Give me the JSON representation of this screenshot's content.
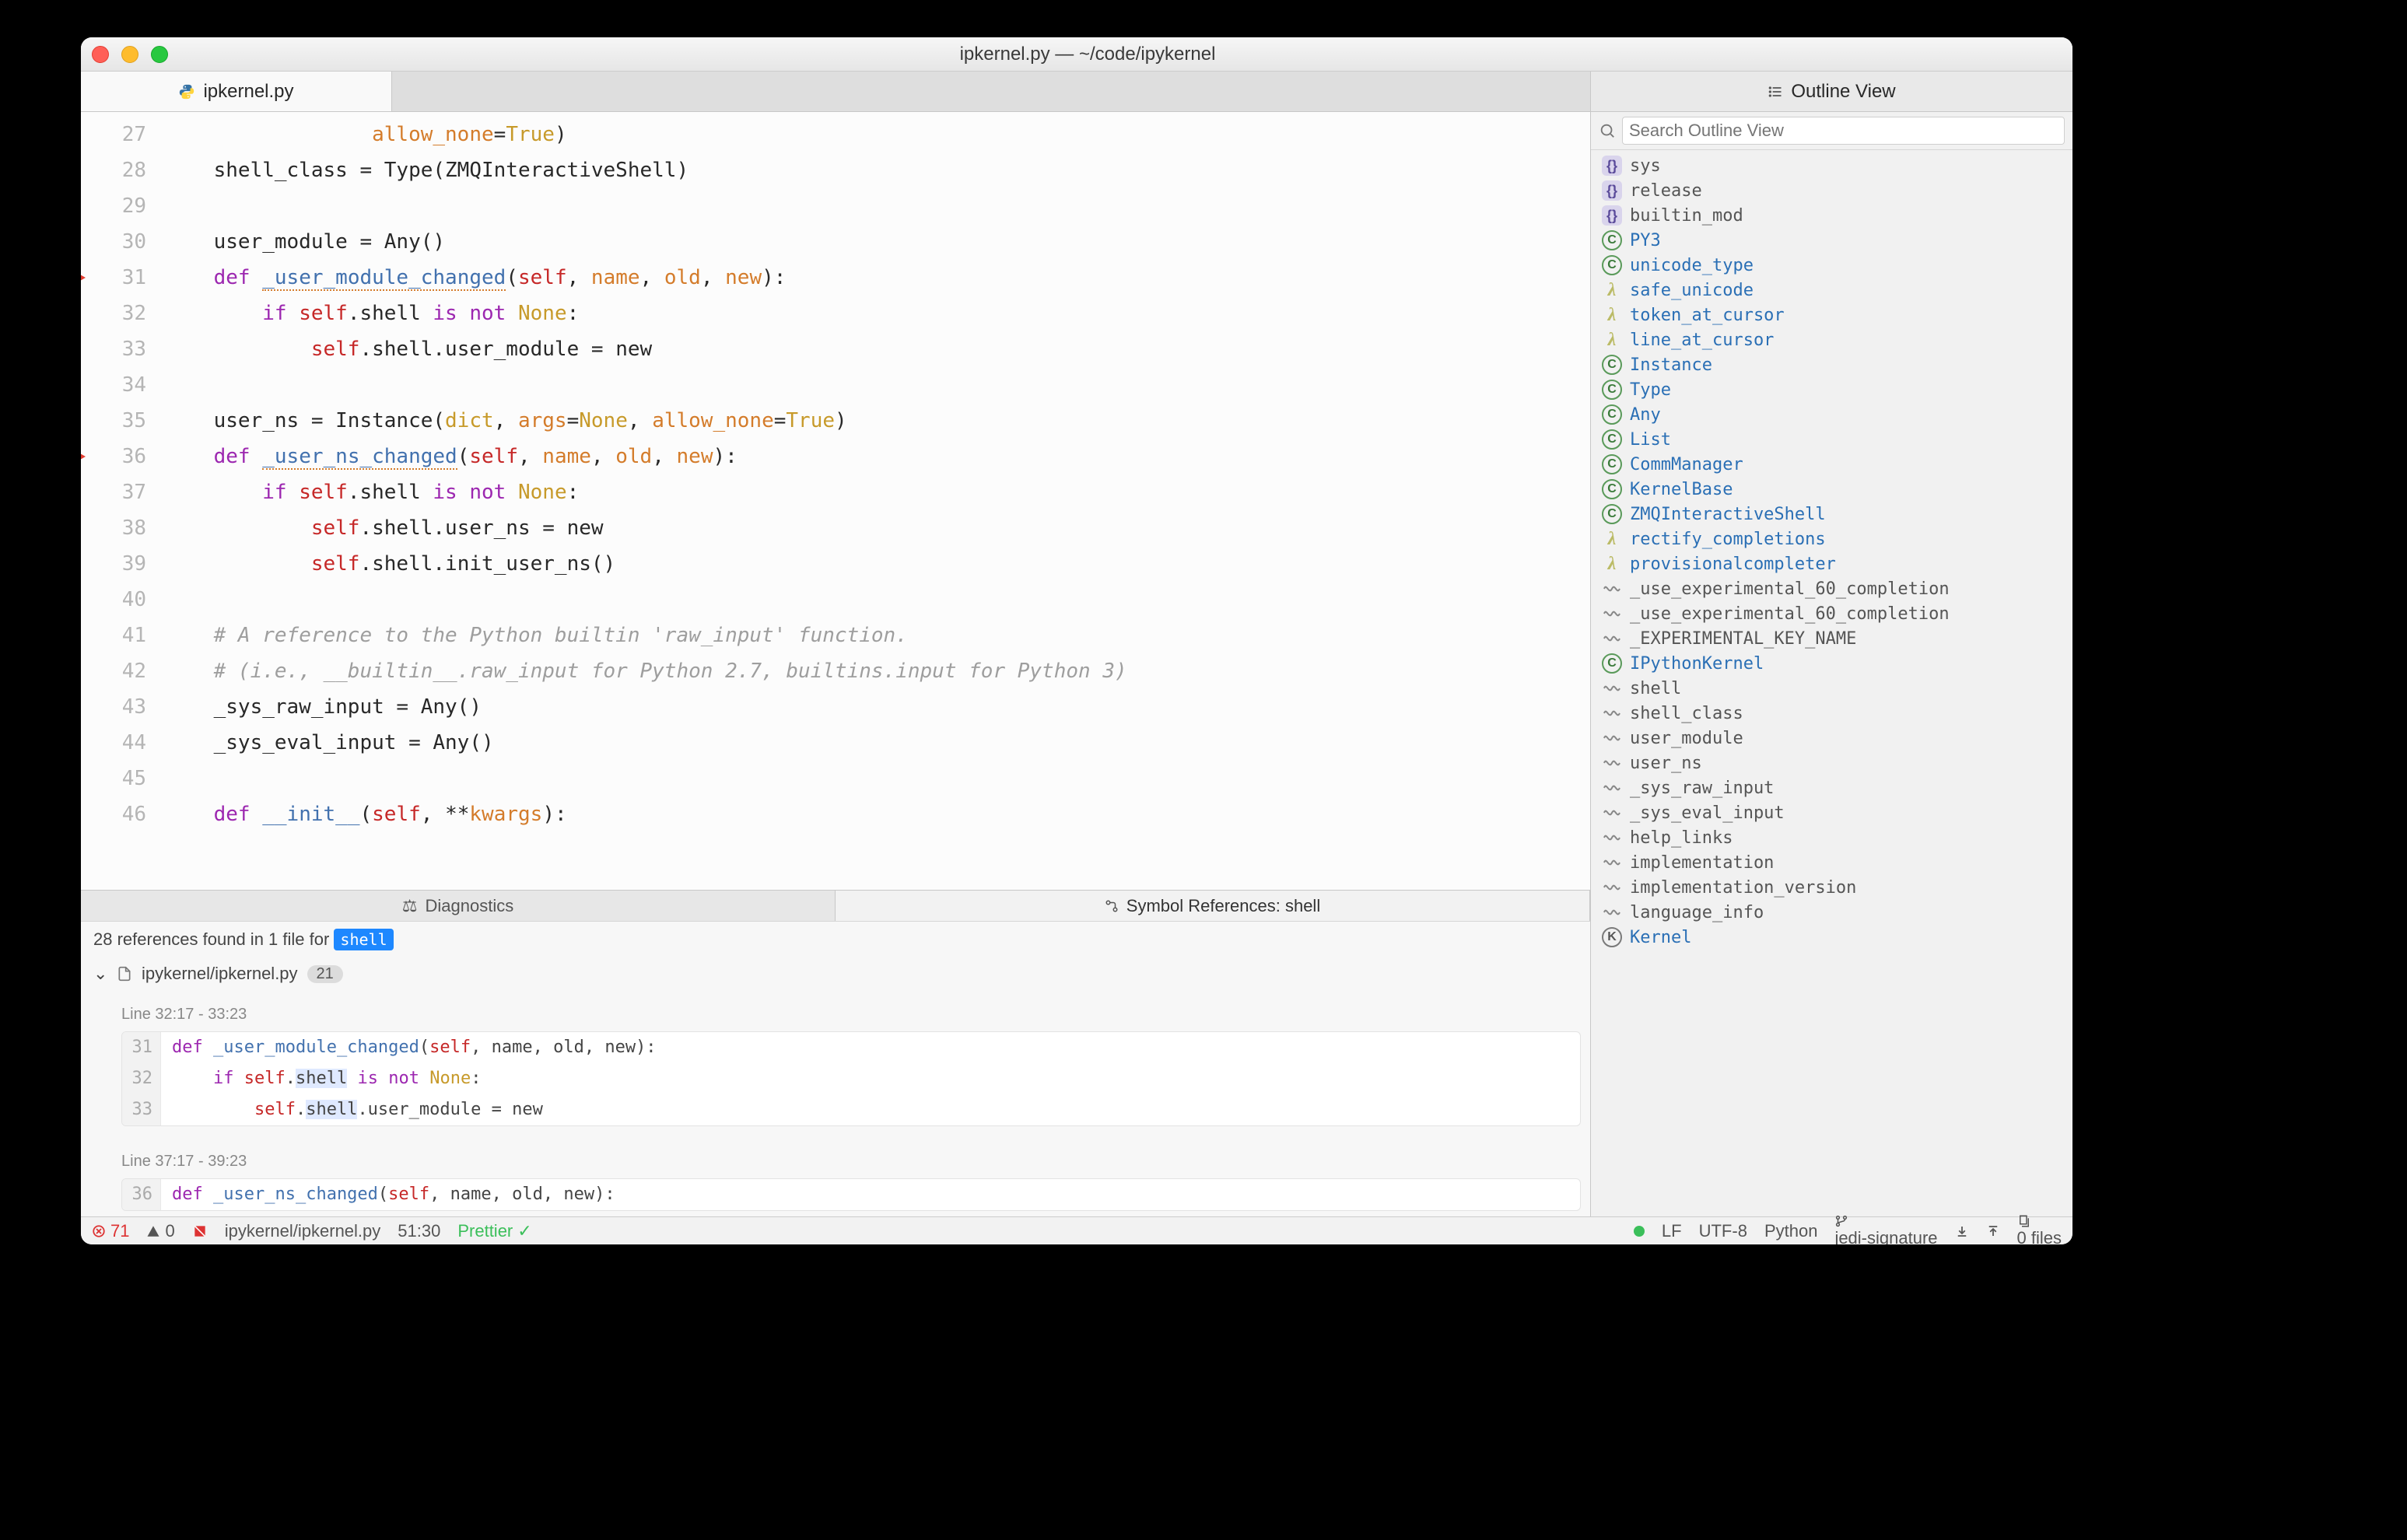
{
  "titlebar": {
    "title": "ipkernel.py — ~/code/ipykernel"
  },
  "tabs": {
    "active_label": "ipkernel.py"
  },
  "outline_header": "Outline View",
  "outline_search_placeholder": "Search Outline View",
  "editor": {
    "lines": [
      {
        "n": 27,
        "html": "                 <span class='arg'>allow_none</span>=<span class='const'>True</span>)"
      },
      {
        "n": 28,
        "html": "    shell_class = Type(ZMQInteractiveShell)"
      },
      {
        "n": 29,
        "html": ""
      },
      {
        "n": 30,
        "html": "    user_module = Any()"
      },
      {
        "n": 31,
        "bp": true,
        "html": "    <span class='kw'>def</span> <span class='fn-u'>_user_module_changed</span>(<span class='selfc'>self</span>, <span class='arg'>name</span>, <span class='arg'>old</span>, <span class='arg'>new</span>):"
      },
      {
        "n": 32,
        "html": "        <span class='kw'>if</span> <span class='selfc'>self</span>.shell <span class='kw'>is</span> <span class='kw'>not</span> <span class='const'>None</span>:"
      },
      {
        "n": 33,
        "html": "            <span class='selfc'>self</span>.shell.user_module = new"
      },
      {
        "n": 34,
        "html": ""
      },
      {
        "n": 35,
        "html": "    user_ns = Instance(<span class='builtin'>dict</span>, <span class='arg'>args</span>=<span class='const'>None</span>, <span class='arg'>allow_none</span>=<span class='const'>True</span>)"
      },
      {
        "n": 36,
        "bp": true,
        "html": "    <span class='kw'>def</span> <span class='fn-u'>_user_ns_changed</span>(<span class='selfc'>self</span>, <span class='arg'>name</span>, <span class='arg'>old</span>, <span class='arg'>new</span>):"
      },
      {
        "n": 37,
        "html": "        <span class='kw'>if</span> <span class='selfc'>self</span>.shell <span class='kw'>is</span> <span class='kw'>not</span> <span class='const'>None</span>:"
      },
      {
        "n": 38,
        "html": "            <span class='selfc'>self</span>.shell.user_ns = new"
      },
      {
        "n": 39,
        "html": "            <span class='selfc'>self</span>.shell.init_user_ns()"
      },
      {
        "n": 40,
        "html": ""
      },
      {
        "n": 41,
        "html": "    <span class='cmt'># A reference to the Python builtin 'raw_input' function.</span>"
      },
      {
        "n": 42,
        "html": "    <span class='cmt'># (i.e., __builtin__.raw_input for Python 2.7, builtins.input for Python 3)</span>"
      },
      {
        "n": 43,
        "html": "    _sys_raw_input = Any()"
      },
      {
        "n": 44,
        "html": "    _sys_eval_input = Any()"
      },
      {
        "n": 45,
        "html": ""
      },
      {
        "n": 46,
        "html": "    <span class='kw'>def</span> <span class='fn'>__init__</span>(<span class='selfc'>self</span>, **<span class='arg'>kwargs</span>):"
      }
    ]
  },
  "panel_tabs": {
    "diagnostics": "Diagnostics",
    "symbol_refs": "Symbol References: shell"
  },
  "results": {
    "summary_prefix": "28 references found in 1 file for ",
    "summary_token": "shell",
    "file": "ipykernel/ipkernel.py",
    "file_count": "21",
    "blocks": [
      {
        "range": "Line 32:17 - 33:23",
        "lines": [
          {
            "n": 31,
            "html": "<span class='kw'>def</span> <span class='fn'>_user_module_changed</span>(<span class='selfc'>self</span>, name, old, new):"
          },
          {
            "n": 32,
            "html": "    <span class='kw'>if</span> <span class='selfc'>self</span>.<span class='hl'>shell</span> <span class='kw'>is</span> <span class='kw'>not</span> <span class='const'>None</span>:"
          },
          {
            "n": 33,
            "html": "        <span class='selfc'>self</span>.<span class='hl'>shell</span>.user_module = new"
          }
        ]
      },
      {
        "range": "Line 37:17 - 39:23",
        "lines": [
          {
            "n": 36,
            "html": "<span class='kw'>def</span> <span class='fn'>_user_ns_changed</span>(<span class='selfc'>self</span>, name, old, new):"
          }
        ]
      }
    ]
  },
  "outline": [
    {
      "kind": "ns",
      "label": "sys",
      "cls": "plain"
    },
    {
      "kind": "ns",
      "label": "release",
      "cls": "plain"
    },
    {
      "kind": "ns",
      "label": "builtin_mod",
      "cls": "plain"
    },
    {
      "kind": "c",
      "label": "PY3",
      "cls": "link"
    },
    {
      "kind": "c",
      "label": "unicode_type",
      "cls": "link"
    },
    {
      "kind": "l",
      "label": "safe_unicode",
      "cls": "link"
    },
    {
      "kind": "l",
      "label": "token_at_cursor",
      "cls": "link"
    },
    {
      "kind": "l",
      "label": "line_at_cursor",
      "cls": "link"
    },
    {
      "kind": "c",
      "label": "Instance",
      "cls": "link"
    },
    {
      "kind": "c",
      "label": "Type",
      "cls": "link"
    },
    {
      "kind": "c",
      "label": "Any",
      "cls": "link"
    },
    {
      "kind": "c",
      "label": "List",
      "cls": "link"
    },
    {
      "kind": "c",
      "label": "CommManager",
      "cls": "link"
    },
    {
      "kind": "c",
      "label": "KernelBase",
      "cls": "link"
    },
    {
      "kind": "c",
      "label": "ZMQInteractiveShell",
      "cls": "link"
    },
    {
      "kind": "l",
      "label": "rectify_completions",
      "cls": "link"
    },
    {
      "kind": "l",
      "label": "provisionalcompleter",
      "cls": "link"
    },
    {
      "kind": "v",
      "label": "_use_experimental_60_completion",
      "cls": "plain"
    },
    {
      "kind": "v",
      "label": "_use_experimental_60_completion",
      "cls": "plain"
    },
    {
      "kind": "v",
      "label": "_EXPERIMENTAL_KEY_NAME",
      "cls": "plain"
    },
    {
      "kind": "c",
      "label": "IPythonKernel",
      "cls": "link"
    },
    {
      "kind": "v",
      "label": "shell",
      "cls": "plain"
    },
    {
      "kind": "v",
      "label": "shell_class",
      "cls": "plain"
    },
    {
      "kind": "v",
      "label": "user_module",
      "cls": "plain"
    },
    {
      "kind": "v",
      "label": "user_ns",
      "cls": "plain"
    },
    {
      "kind": "v",
      "label": "_sys_raw_input",
      "cls": "plain"
    },
    {
      "kind": "v",
      "label": "_sys_eval_input",
      "cls": "plain"
    },
    {
      "kind": "v",
      "label": "help_links",
      "cls": "plain"
    },
    {
      "kind": "v",
      "label": "implementation",
      "cls": "plain"
    },
    {
      "kind": "v",
      "label": "implementation_version",
      "cls": "plain"
    },
    {
      "kind": "v",
      "label": "language_info",
      "cls": "plain"
    },
    {
      "kind": "k",
      "label": "Kernel",
      "cls": "link"
    }
  ],
  "status": {
    "errors": "71",
    "warnings": "0",
    "path": "ipykernel/ipkernel.py",
    "cursor": "51:30",
    "prettier": "Prettier",
    "eol": "LF",
    "encoding": "UTF-8",
    "language": "Python",
    "signature": "jedi-signature",
    "files": "0 files"
  }
}
